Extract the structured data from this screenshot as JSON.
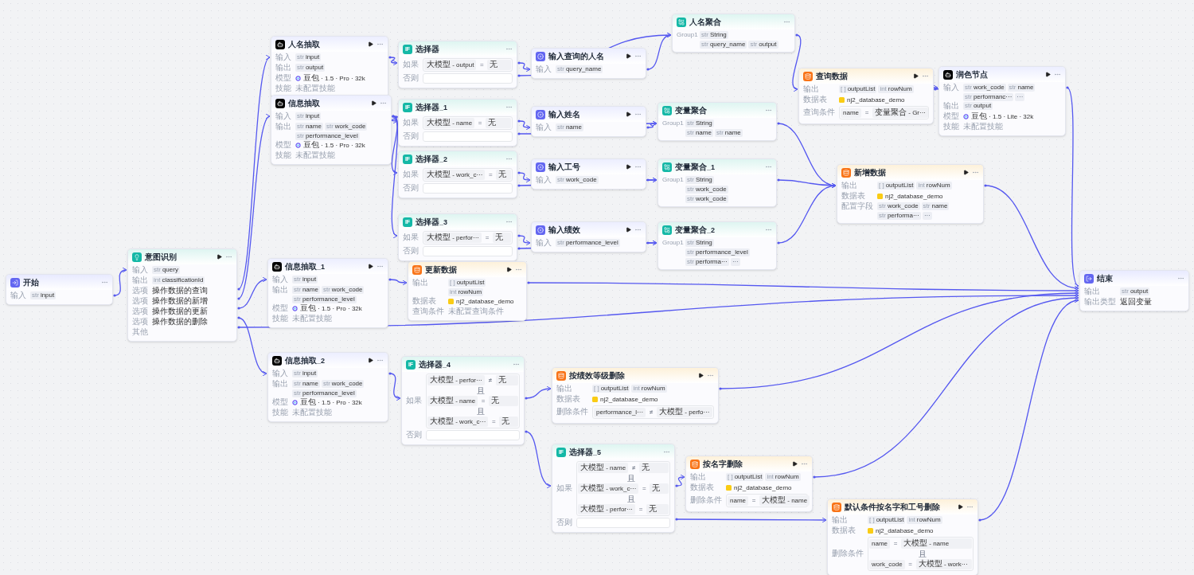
{
  "canvas": {
    "nodes": [
      {
        "kind": "start",
        "title": "开始",
        "runnable": false,
        "rows": [
          {
            "kind": "tags",
            "label": "输入",
            "tags": [
              {
                "type": "str",
                "name": "input"
              }
            ]
          }
        ]
      },
      {
        "kind": "intent",
        "title": "意图识别",
        "runnable": true,
        "rows": [
          {
            "kind": "tags",
            "label": "输入",
            "tags": [
              {
                "type": "str",
                "name": "query"
              }
            ]
          },
          {
            "kind": "tags",
            "label": "输出",
            "tags": [
              {
                "type": "int",
                "name": "classificationId"
              }
            ]
          },
          {
            "kind": "option",
            "label": "选项",
            "value": "操作数据的查询"
          },
          {
            "kind": "option",
            "label": "选项",
            "value": "操作数据的新增"
          },
          {
            "kind": "option",
            "label": "选项",
            "value": "操作数据的更新"
          },
          {
            "kind": "option",
            "label": "选项",
            "value": "操作数据的删除"
          },
          {
            "kind": "option",
            "label": "其他"
          }
        ]
      },
      {
        "kind": "llm",
        "title": "人名抽取",
        "runnable": true,
        "rows": [
          {
            "kind": "tags",
            "label": "输入",
            "tags": [
              {
                "type": "str",
                "name": "input"
              }
            ]
          },
          {
            "kind": "tags",
            "label": "输出",
            "tags": [
              {
                "type": "str",
                "name": "output"
              }
            ]
          },
          {
            "kind": "model",
            "label": "模型",
            "value": "豆包 · 1.5 · Pro · 32k"
          },
          {
            "kind": "muted",
            "label": "技能",
            "value": "未配置技能"
          }
        ]
      },
      {
        "kind": "llm",
        "title": "信息抽取",
        "runnable": true,
        "rows": [
          {
            "kind": "tags",
            "label": "输入",
            "tags": [
              {
                "type": "str",
                "name": "input"
              }
            ]
          },
          {
            "kind": "tags",
            "label": "输出",
            "tags": [
              {
                "type": "str",
                "name": "name"
              },
              {
                "type": "str",
                "name": "work_code"
              },
              {
                "type": "str",
                "name": "performance_level"
              }
            ]
          },
          {
            "kind": "model",
            "label": "模型",
            "value": "豆包 · 1.5 · Pro · 32k"
          },
          {
            "kind": "muted",
            "label": "技能",
            "value": "未配置技能"
          }
        ]
      },
      {
        "kind": "llm",
        "title": "信息抽取_1",
        "runnable": true,
        "rows": [
          {
            "kind": "tags",
            "label": "输入",
            "tags": [
              {
                "type": "str",
                "name": "input"
              }
            ]
          },
          {
            "kind": "tags",
            "label": "输出",
            "tags": [
              {
                "type": "str",
                "name": "name"
              },
              {
                "type": "str",
                "name": "work_code"
              },
              {
                "type": "str",
                "name": "performance_level"
              }
            ]
          },
          {
            "kind": "model",
            "label": "模型",
            "value": "豆包 · 1.5 · Pro · 32k"
          },
          {
            "kind": "muted",
            "label": "技能",
            "value": "未配置技能"
          }
        ]
      },
      {
        "kind": "llm",
        "title": "信息抽取_2",
        "runnable": true,
        "rows": [
          {
            "kind": "tags",
            "label": "输入",
            "tags": [
              {
                "type": "str",
                "name": "input"
              }
            ]
          },
          {
            "kind": "tags",
            "label": "输出",
            "tags": [
              {
                "type": "str",
                "name": "name"
              },
              {
                "type": "str",
                "name": "work_code"
              },
              {
                "type": "str",
                "name": "performance_level"
              }
            ]
          },
          {
            "kind": "model",
            "label": "模型",
            "value": "豆包 · 1.5 · Pro · 32k"
          },
          {
            "kind": "muted",
            "label": "技能",
            "value": "未配置技能"
          }
        ]
      },
      {
        "kind": "selector",
        "badge": "IF",
        "title": "选择器",
        "runnable": false,
        "rows": [
          {
            "kind": "conditions",
            "label": "如果",
            "conditions": [
              {
                "left": "大模型 - output",
                "op": "=",
                "right": "无"
              }
            ]
          },
          {
            "kind": "field",
            "label": "否则"
          }
        ]
      },
      {
        "kind": "selector",
        "badge": "IF",
        "title": "选择器_1",
        "runnable": false,
        "rows": [
          {
            "kind": "conditions",
            "label": "如果",
            "conditions": [
              {
                "left": "大模型 - name",
                "op": "=",
                "right": "无"
              }
            ]
          },
          {
            "kind": "field",
            "label": "否则"
          }
        ]
      },
      {
        "kind": "selector",
        "badge": "IF",
        "title": "选择器_2",
        "runnable": false,
        "rows": [
          {
            "kind": "conditions",
            "label": "如果",
            "conditions": [
              {
                "left": "大模型 - work_c···",
                "op": "=",
                "right": "无"
              }
            ]
          },
          {
            "kind": "field",
            "label": "否则"
          }
        ]
      },
      {
        "kind": "selector",
        "badge": "IF",
        "title": "选择器_3",
        "runnable": false,
        "rows": [
          {
            "kind": "conditions",
            "label": "如果",
            "conditions": [
              {
                "left": "大模型 - perfor···",
                "op": "=",
                "right": "无"
              }
            ]
          },
          {
            "kind": "field",
            "label": "否则"
          }
        ]
      },
      {
        "kind": "database",
        "title": "更新数据",
        "runnable": true,
        "rows": [
          {
            "kind": "tags",
            "label": "输出",
            "tags": [
              {
                "type": "[ ]",
                "name": "outputList"
              },
              {
                "type": "int",
                "name": "rowNum"
              }
            ]
          },
          {
            "kind": "table",
            "label": "数据表",
            "value": "nj2_database_demo"
          },
          {
            "kind": "muted",
            "label": "查询条件",
            "value": "未配置查询条件"
          }
        ]
      },
      {
        "kind": "input",
        "title": "输入查询的人名",
        "runnable": true,
        "rows": [
          {
            "kind": "tags",
            "label": "输入",
            "tags": [
              {
                "type": "str",
                "name": "query_name"
              }
            ]
          }
        ]
      },
      {
        "kind": "input",
        "title": "输入姓名",
        "runnable": true,
        "rows": [
          {
            "kind": "tags",
            "label": "输入",
            "tags": [
              {
                "type": "str",
                "name": "name"
              }
            ]
          }
        ]
      },
      {
        "kind": "input",
        "title": "输入工号",
        "runnable": true,
        "rows": [
          {
            "kind": "tags",
            "label": "输入",
            "tags": [
              {
                "type": "str",
                "name": "work_code"
              }
            ]
          }
        ]
      },
      {
        "kind": "input",
        "title": "输入绩效",
        "runnable": true,
        "rows": [
          {
            "kind": "tags",
            "label": "输入",
            "tags": [
              {
                "type": "str",
                "name": "performance_level"
              }
            ]
          }
        ]
      },
      {
        "kind": "aggregate",
        "title": "人名聚合",
        "runnable": false,
        "rows": [
          {
            "kind": "tags",
            "label": "Group1",
            "tags": [
              {
                "type": "str",
                "name": "String"
              }
            ]
          },
          {
            "kind": "tags",
            "tags": [
              {
                "type": "str",
                "name": "query_name"
              },
              {
                "type": "str",
                "name": "output"
              }
            ]
          }
        ]
      },
      {
        "kind": "aggregate",
        "title": "变量聚合",
        "runnable": false,
        "rows": [
          {
            "kind": "tags",
            "label": "Group1",
            "tags": [
              {
                "type": "str",
                "name": "String"
              }
            ]
          },
          {
            "kind": "tags",
            "tags": [
              {
                "type": "str",
                "name": "name"
              },
              {
                "type": "str",
                "name": "name"
              }
            ]
          }
        ]
      },
      {
        "kind": "aggregate",
        "title": "变量聚合_1",
        "runnable": false,
        "rows": [
          {
            "kind": "tags",
            "label": "Group1",
            "tags": [
              {
                "type": "str",
                "name": "String"
              }
            ]
          },
          {
            "kind": "tags",
            "tags": [
              {
                "type": "str",
                "name": "work_code"
              },
              {
                "type": "str",
                "name": "work_code"
              }
            ]
          }
        ]
      },
      {
        "kind": "aggregate",
        "title": "变量聚合_2",
        "runnable": false,
        "rows": [
          {
            "kind": "tags",
            "label": "Group1",
            "tags": [
              {
                "type": "str",
                "name": "String"
              }
            ]
          },
          {
            "kind": "tags",
            "tags": [
              {
                "type": "str",
                "name": "performance_level"
              },
              {
                "type": "str",
                "name": "performa···"
              }
            ],
            "more": "···"
          }
        ]
      },
      {
        "kind": "database",
        "title": "查询数据",
        "runnable": true,
        "rows": [
          {
            "kind": "tags",
            "label": "输出",
            "tags": [
              {
                "type": "[ ]",
                "name": "outputList"
              },
              {
                "type": "int",
                "name": "rowNum"
              }
            ]
          },
          {
            "kind": "table",
            "label": "数据表",
            "value": "nj2_database_demo"
          },
          {
            "kind": "conditions",
            "label": "查询条件",
            "conditions": [
              {
                "left": "name",
                "op": "=",
                "right": "变量聚合 - Gr···"
              }
            ]
          }
        ]
      },
      {
        "kind": "llm",
        "title": "润色节点",
        "runnable": true,
        "rows": [
          {
            "kind": "tags",
            "label": "输入",
            "tags": [
              {
                "type": "str",
                "name": "work_code"
              },
              {
                "type": "str",
                "name": "name"
              },
              {
                "type": "str",
                "name": "performanc···"
              }
            ],
            "more": "···"
          },
          {
            "kind": "tags",
            "label": "输出",
            "tags": [
              {
                "type": "str",
                "name": "output"
              }
            ]
          },
          {
            "kind": "model",
            "label": "模型",
            "value": "豆包 · 1.5 · Lite · 32k"
          },
          {
            "kind": "muted",
            "label": "技能",
            "value": "未配置技能"
          }
        ]
      },
      {
        "kind": "database",
        "title": "新增数据",
        "runnable": true,
        "rows": [
          {
            "kind": "tags",
            "label": "输出",
            "tags": [
              {
                "type": "[ ]",
                "name": "outputList"
              },
              {
                "type": "int",
                "name": "rowNum"
              }
            ]
          },
          {
            "kind": "table",
            "label": "数据表",
            "value": "nj2_database_demo"
          },
          {
            "kind": "tags",
            "label": "配置字段",
            "tags": [
              {
                "type": "str",
                "name": "work_code"
              },
              {
                "type": "str",
                "name": "name"
              },
              {
                "type": "str",
                "name": "performa···"
              }
            ],
            "more": "···"
          }
        ]
      },
      {
        "kind": "end",
        "title": "结束",
        "runnable": false,
        "rows": [
          {
            "kind": "tags",
            "label": "输出",
            "tags": [
              {
                "type": "str",
                "name": "output"
              }
            ]
          },
          {
            "kind": "text",
            "label": "输出类型",
            "value": "返回变量"
          }
        ]
      },
      {
        "kind": "selector",
        "badge": "IF",
        "title": "选择器_4",
        "runnable": false,
        "rows": [
          {
            "kind": "conditions",
            "label": "如果",
            "conditions": [
              {
                "left": "大模型 - perfor···",
                "op": "≠",
                "right": "无"
              },
              {
                "joiner": "且",
                "left": "大模型 - name",
                "op": "=",
                "right": "无"
              },
              {
                "joiner": "且",
                "left": "大模型 - work_c···",
                "op": "=",
                "right": "无"
              }
            ]
          },
          {
            "kind": "field",
            "label": "否则"
          }
        ]
      },
      {
        "kind": "database",
        "title": "按绩效等级删除",
        "runnable": true,
        "rows": [
          {
            "kind": "tags",
            "label": "输出",
            "tags": [
              {
                "type": "[ ]",
                "name": "outputList"
              },
              {
                "type": "int",
                "name": "rowNum"
              }
            ]
          },
          {
            "kind": "table",
            "label": "数据表",
            "value": "nj2_database_demo"
          },
          {
            "kind": "conditions",
            "label": "删除条件",
            "conditions": [
              {
                "left": "performance_l···",
                "op": "≠",
                "right": "大模型 - perfo···"
              }
            ]
          }
        ]
      },
      {
        "kind": "selector",
        "badge": "IF",
        "title": "选择器_5",
        "runnable": false,
        "rows": [
          {
            "kind": "conditions",
            "label": "如果",
            "conditions": [
              {
                "left": "大模型 - name",
                "op": "≠",
                "right": "无"
              },
              {
                "joiner": "且",
                "left": "大模型 - work_c···",
                "op": "=",
                "right": "无"
              },
              {
                "joiner": "且",
                "left": "大模型 - perfor···",
                "op": "=",
                "right": "无"
              }
            ]
          },
          {
            "kind": "field",
            "label": "否则"
          }
        ]
      },
      {
        "kind": "database",
        "title": "按名字删除",
        "runnable": true,
        "rows": [
          {
            "kind": "tags",
            "label": "输出",
            "tags": [
              {
                "type": "[ ]",
                "name": "outputList"
              },
              {
                "type": "int",
                "name": "rowNum"
              }
            ]
          },
          {
            "kind": "table",
            "label": "数据表",
            "value": "nj2_database_demo"
          },
          {
            "kind": "conditions",
            "label": "删除条件",
            "conditions": [
              {
                "left": "name",
                "op": "=",
                "right": "大模型 - name"
              }
            ]
          }
        ]
      },
      {
        "kind": "database",
        "title": "默认条件按名字和工号删除",
        "runnable": true,
        "rows": [
          {
            "kind": "tags",
            "label": "输出",
            "tags": [
              {
                "type": "[ ]",
                "name": "outputList"
              },
              {
                "type": "int",
                "name": "rowNum"
              }
            ]
          },
          {
            "kind": "table",
            "label": "数据表",
            "value": "nj2_database_demo"
          },
          {
            "kind": "conditions",
            "label": "删除条件",
            "conditions": [
              {
                "left": "name",
                "op": "=",
                "right": "大模型 - name"
              },
              {
                "joiner": "且",
                "left": "work_code",
                "op": "=",
                "right": "大模型 - work···"
              }
            ]
          }
        ]
      }
    ]
  }
}
